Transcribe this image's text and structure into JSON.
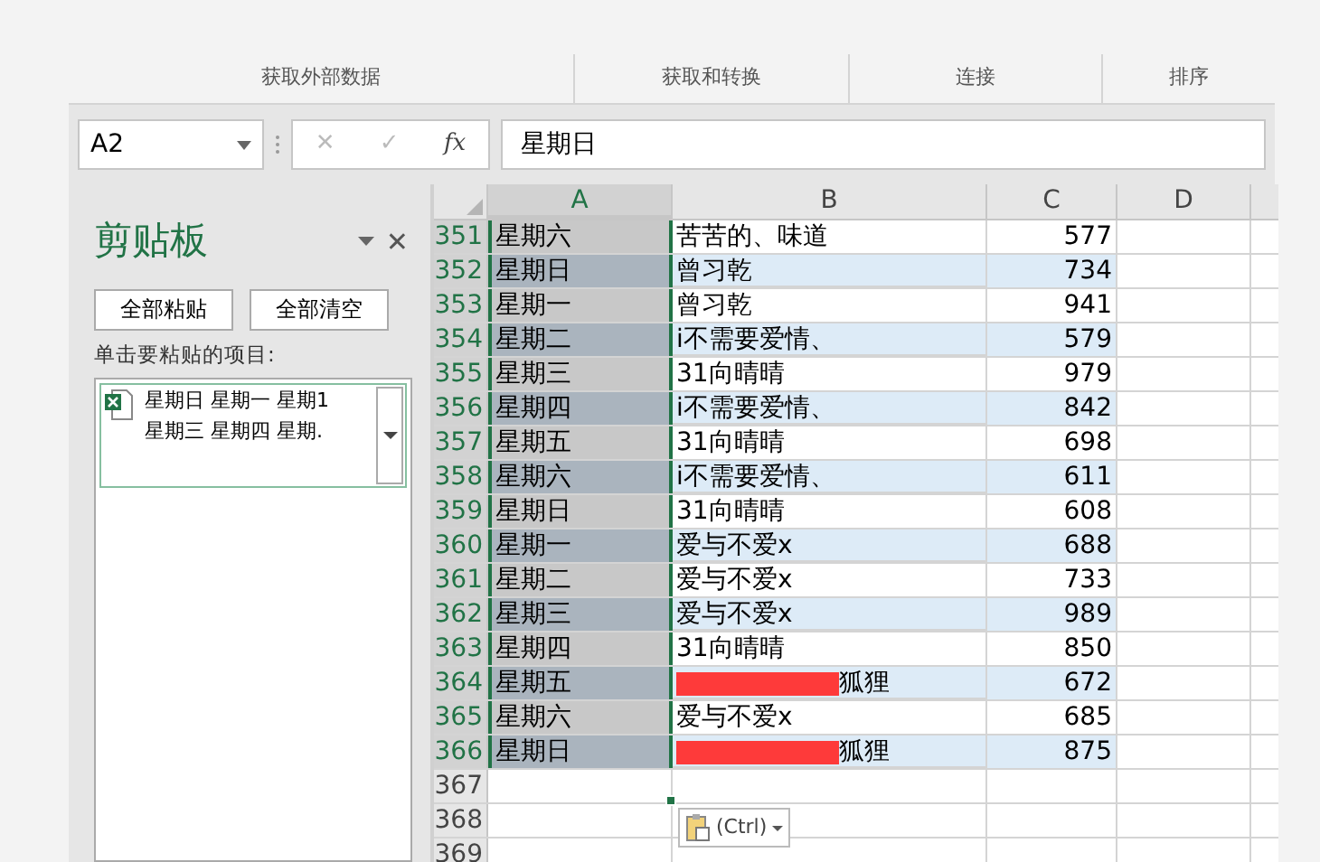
{
  "ribbon_groups": [
    "获取外部数据",
    "获取和转换",
    "连接",
    "排序"
  ],
  "formula_bar": {
    "name_box": "A2",
    "cancel": "✕",
    "enter": "✓",
    "fx": "fx",
    "value": "星期日"
  },
  "clipboard": {
    "title": "剪贴板",
    "close": "✕",
    "paste_all": "全部粘贴",
    "clear_all": "全部清空",
    "instruction": "单击要粘贴的项目:",
    "items": [
      {
        "line_1": "星期日 星期一 星期1",
        "line_2": "星期三 星期四 星期."
      }
    ]
  },
  "columns": [
    "A",
    "B",
    "C",
    "D"
  ],
  "rows": [
    {
      "num": "351",
      "a": "星期六",
      "b": "苦苦的、味道",
      "c": "577",
      "banded": false,
      "redacted": false
    },
    {
      "num": "352",
      "a": "星期日",
      "b": "曾习乾",
      "c": "734",
      "banded": true,
      "redacted": false
    },
    {
      "num": "353",
      "a": "星期一",
      "b": "曾习乾",
      "c": "941",
      "banded": false,
      "redacted": false
    },
    {
      "num": "354",
      "a": "星期二",
      "b": "i不需要爱情、",
      "c": "579",
      "banded": true,
      "redacted": false
    },
    {
      "num": "355",
      "a": "星期三",
      "b": "31向晴晴",
      "c": "979",
      "banded": false,
      "redacted": false
    },
    {
      "num": "356",
      "a": "星期四",
      "b": "i不需要爱情、",
      "c": "842",
      "banded": true,
      "redacted": false
    },
    {
      "num": "357",
      "a": "星期五",
      "b": "31向晴晴",
      "c": "698",
      "banded": false,
      "redacted": false
    },
    {
      "num": "358",
      "a": "星期六",
      "b": "i不需要爱情、",
      "c": "611",
      "banded": true,
      "redacted": false
    },
    {
      "num": "359",
      "a": "星期日",
      "b": "31向晴晴",
      "c": "608",
      "banded": false,
      "redacted": false
    },
    {
      "num": "360",
      "a": "星期一",
      "b": "爱与不爱x",
      "c": "688",
      "banded": true,
      "redacted": false
    },
    {
      "num": "361",
      "a": "星期二",
      "b": "爱与不爱x",
      "c": "733",
      "banded": false,
      "redacted": false
    },
    {
      "num": "362",
      "a": "星期三",
      "b": "爱与不爱x",
      "c": "989",
      "banded": true,
      "redacted": false
    },
    {
      "num": "363",
      "a": "星期四",
      "b": "31向晴晴",
      "c": "850",
      "banded": false,
      "redacted": false
    },
    {
      "num": "364",
      "a": "星期五",
      "b": "狐狸",
      "c": "672",
      "banded": true,
      "redacted": true
    },
    {
      "num": "365",
      "a": "星期六",
      "b": "爱与不爱x",
      "c": "685",
      "banded": false,
      "redacted": false
    },
    {
      "num": "366",
      "a": "星期日",
      "b": "狐狸",
      "c": "875",
      "banded": true,
      "redacted": true
    },
    {
      "num": "367",
      "a": "",
      "b": "",
      "c": "",
      "banded": false,
      "redacted": false
    },
    {
      "num": "368",
      "a": "",
      "b": "",
      "c": "",
      "banded": false,
      "redacted": false
    },
    {
      "num": "369",
      "a": "",
      "b": "",
      "c": "",
      "banded": false,
      "redacted": false
    }
  ],
  "paste_options": {
    "label": "(Ctrl)"
  }
}
